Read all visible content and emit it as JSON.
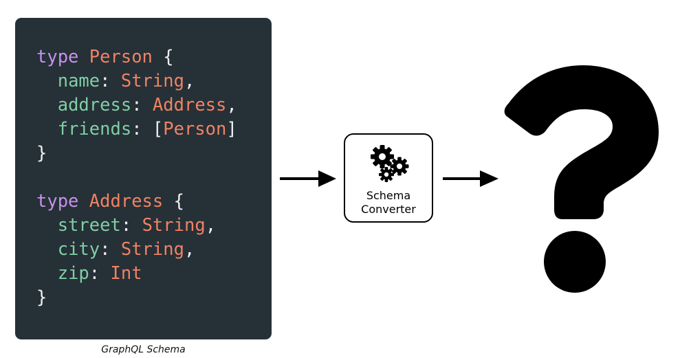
{
  "schema_panel": {
    "caption": "GraphQL Schema",
    "types": [
      {
        "keyword": "type",
        "name": "Person",
        "open": "{",
        "close": "}",
        "fields": [
          {
            "name": "name",
            "type": "String",
            "trailing": ","
          },
          {
            "name": "address",
            "type": "Address",
            "trailing": ","
          },
          {
            "name": "friends",
            "type": "Person",
            "list": true,
            "trailing": ""
          }
        ]
      },
      {
        "keyword": "type",
        "name": "Address",
        "open": "{",
        "close": "}",
        "fields": [
          {
            "name": "street",
            "type": "String",
            "trailing": ","
          },
          {
            "name": "city",
            "type": "String",
            "trailing": ","
          },
          {
            "name": "zip",
            "type": "Int",
            "trailing": ""
          }
        ]
      }
    ]
  },
  "converter": {
    "icon": "gears-icon",
    "label_line1": "Schema",
    "label_line2": "Converter"
  },
  "output": {
    "icon": "question-mark-icon"
  },
  "colors": {
    "panel_bg": "#263037",
    "keyword": "#c792ea",
    "type": "#f08363",
    "field": "#7fcfa4",
    "punctuation": "#eef0f2"
  }
}
